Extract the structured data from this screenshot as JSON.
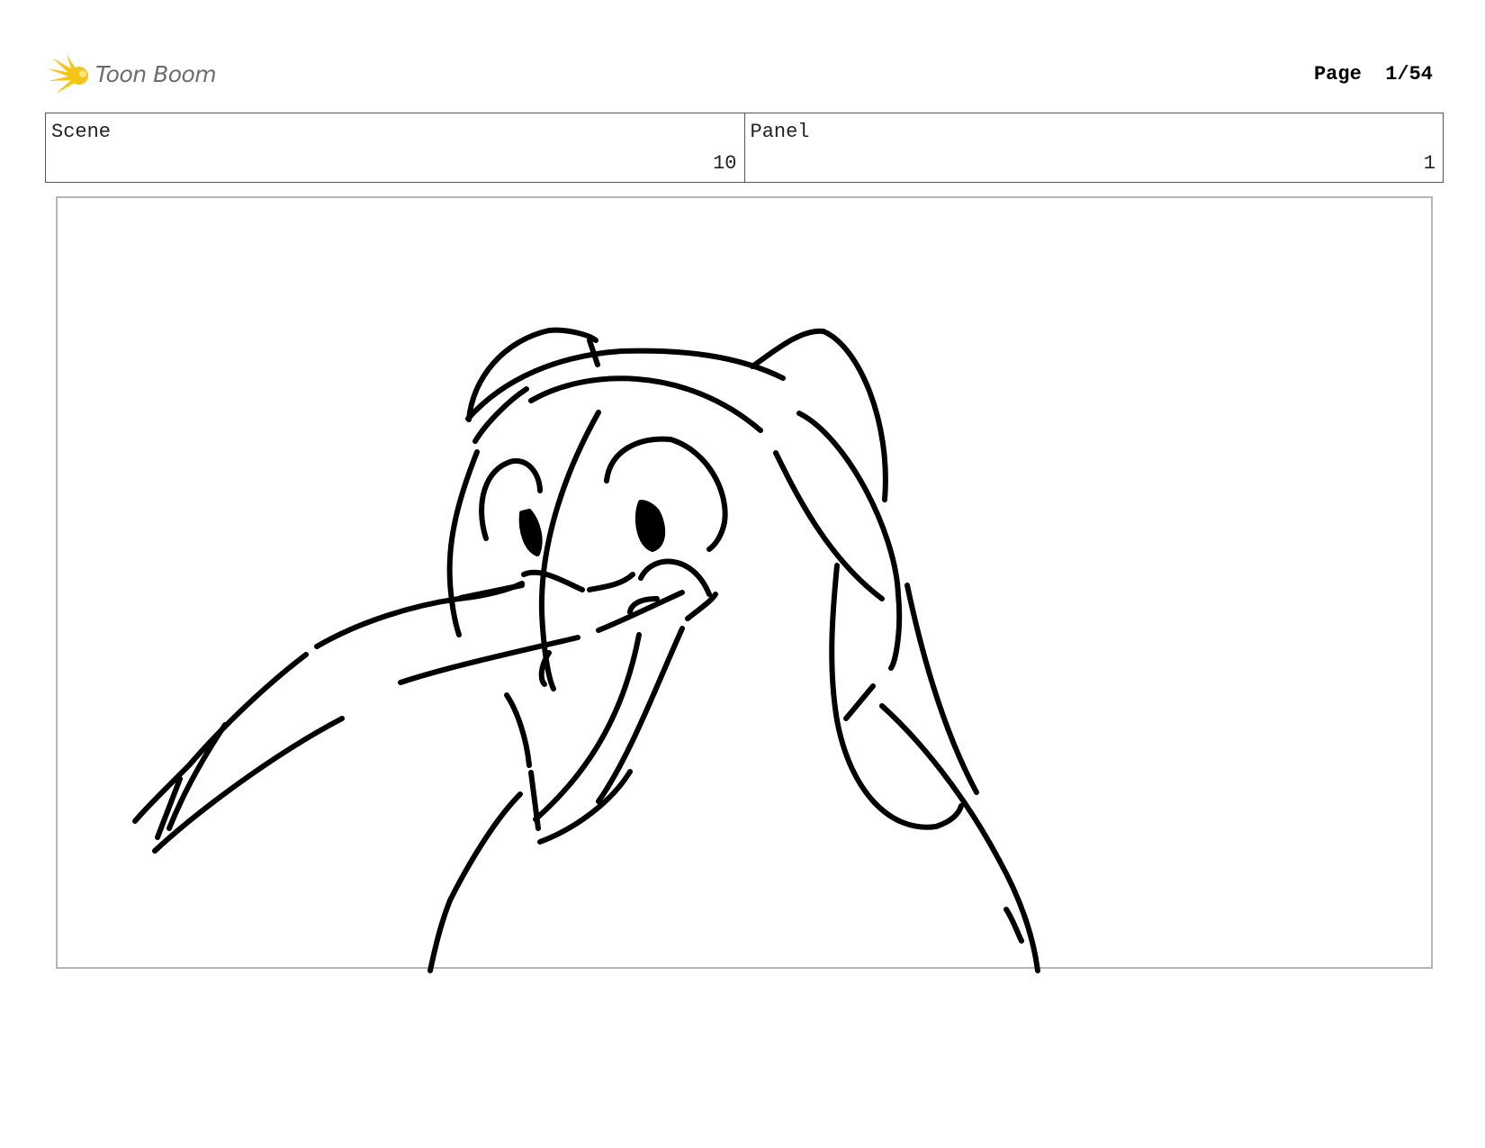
{
  "header": {
    "logo_text": "Toon Boom",
    "logo_icon": "starburst-icon",
    "page_label": "Page",
    "page_value": "1/54"
  },
  "info": {
    "scene_label": "Scene",
    "scene_value": "10",
    "panel_label": "Panel",
    "panel_value": "1"
  },
  "panel": {
    "drawing": "penguin-sketch"
  },
  "colors": {
    "logo_yellow": "#f5c518",
    "logo_text": "#6d6d6d",
    "frame_border": "#b5b5b5",
    "ink": "#000000"
  }
}
